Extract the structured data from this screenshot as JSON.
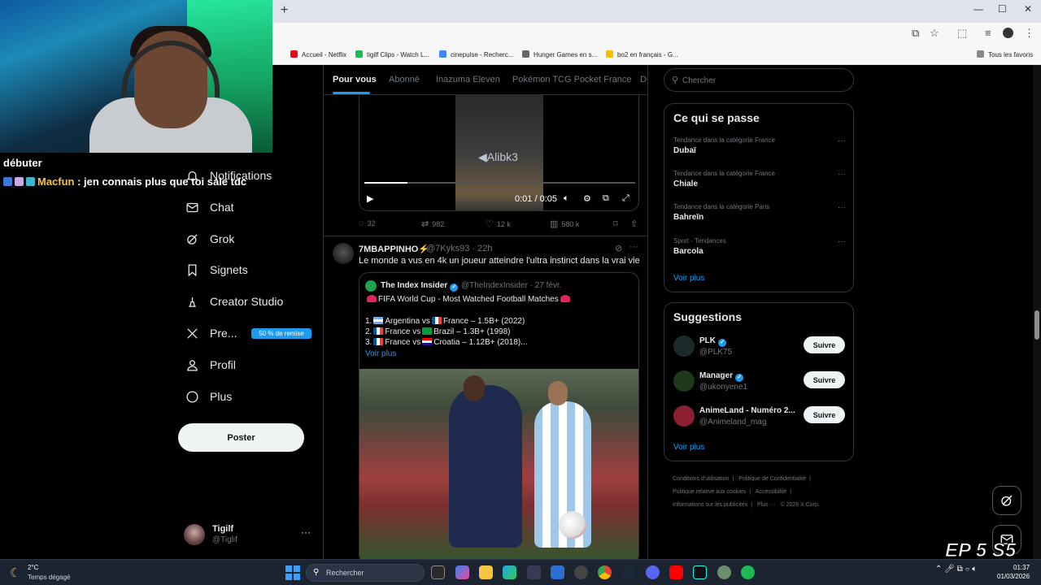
{
  "browser": {
    "new_tab": "+",
    "window_controls": [
      "—",
      "☐",
      "✕"
    ],
    "bookmarks": [
      {
        "label": "Accueil - Netflix",
        "color": "#e50914"
      },
      {
        "label": "tigilf Clips - Watch L...",
        "color": "#1db954"
      },
      {
        "label": "cinepulse - Recherc...",
        "color": "#4285f4"
      },
      {
        "label": "Hunger Games en s...",
        "color": "#666666"
      },
      {
        "label": "bo2 en français - G...",
        "color": "#fbbc04"
      }
    ],
    "all_bookmarks": "Tous les favoris"
  },
  "stream": {
    "word": "débuter",
    "chat_user": "Macfun",
    "chat_text": " : jen connais plus que toi sale tdc",
    "episode": "EP 5 S5"
  },
  "nav": {
    "items": [
      {
        "label": "Notifications",
        "icon": "bell-icon"
      },
      {
        "label": "Chat",
        "icon": "mail-icon"
      },
      {
        "label": "Grok",
        "icon": "grok-icon"
      },
      {
        "label": "Signets",
        "icon": "bookmark-icon"
      },
      {
        "label": "Creator Studio",
        "icon": "creator-icon"
      },
      {
        "label": "Pre...",
        "icon": "x-icon"
      },
      {
        "label": "Profil",
        "icon": "person-icon"
      },
      {
        "label": "Plus",
        "icon": "more-circle-icon"
      }
    ],
    "premium_badge": "50 % de remise",
    "post_button": "Poster",
    "account": {
      "name": "Tigilf",
      "handle": "@Tiglif",
      "more": "···"
    }
  },
  "feed": {
    "tabs": [
      "Pour vous",
      "Abonné",
      "Inazuma Eleven",
      "Pokémon TCG Pocket France",
      "DC"
    ],
    "video": {
      "watermark": "Alibk3",
      "time": "0:01 / 0:05",
      "progress": 0.16
    },
    "tweet1_actions": {
      "replies": "32",
      "reposts": "982",
      "likes": "12 k",
      "views": "580 k"
    },
    "tweet2": {
      "name": "7MBAPPINHO⚡",
      "meta": "@7Kyks93 · 22h",
      "text": "Le monde a vus en 4k un joueur atteindre l'ultra instinct dans la vrai vie",
      "quote": {
        "name": "The Index Insider",
        "meta": "@TheIndexInsider · 27 févr.",
        "title": "FIFA World Cup - Most Watched Football Matches",
        "lines": [
          {
            "num": "1.",
            "a": "Argentina vs",
            "b": "France – 1.5B+ (2022)"
          },
          {
            "num": "2.",
            "a": "France vs",
            "b": "Brazil – 1.3B+ (1998)"
          },
          {
            "num": "3.",
            "a": "France vs",
            "b": "Croatia – 1.12B+ (2018)..."
          }
        ],
        "see_more": "Voir plus"
      }
    }
  },
  "sidebar": {
    "search_placeholder": "Chercher",
    "trends_title": "Ce qui se passe",
    "trends": [
      {
        "context": "Tendance dans la catégorie France",
        "name": "Dubaï"
      },
      {
        "context": "Tendance dans la catégorie France",
        "name": "Chiale"
      },
      {
        "context": "Tendance dans la catégorie Paris",
        "name": "Bahreïn"
      },
      {
        "context": "Sport · Tendances",
        "name": "Barcola"
      }
    ],
    "see_more": "Voir plus",
    "suggestions_title": "Suggestions",
    "suggestions": [
      {
        "name": "PLK",
        "handle": "@PLK75",
        "follow": "Suivre",
        "color": "#1a2a2a"
      },
      {
        "name": "Manager",
        "handle": "@ukonyene1",
        "follow": "Suivre",
        "color": "#1f3a1a"
      },
      {
        "name": "AnimeLand - Numéro 2...",
        "handle": "@Animeland_mag",
        "follow": "Suivre",
        "color": "#8a2030"
      }
    ],
    "footer": [
      "Conditions d'utilisation",
      "|",
      "Politique de Confidentialité",
      "|",
      "Politique relative aux cookies",
      "|",
      "Accessibilité",
      "|",
      "Informations sur les publicités",
      "|",
      "Plus ···",
      "© 2026 X Corp."
    ]
  },
  "taskbar": {
    "temp": "2°C",
    "weather": "Temps dégagé",
    "search": "Rechercher",
    "time": "01:37",
    "date": "01/03/2026"
  }
}
